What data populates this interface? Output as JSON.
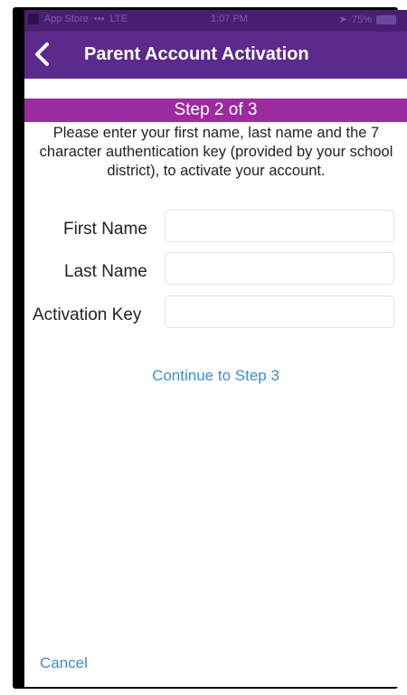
{
  "status_bar": {
    "carrier": "App Store",
    "network": "LTE",
    "time": "1:07 PM",
    "battery": "75%"
  },
  "nav": {
    "title": "Parent Account Activation",
    "back_icon": "chevron-left-icon"
  },
  "step": {
    "label": "Step 2 of 3"
  },
  "instructions": "Please enter your first name, last name and the 7 character authentication key (provided by your school district), to activate your account.",
  "form": {
    "first_name_label": "First Name",
    "first_name_value": "",
    "last_name_label": "Last Name",
    "last_name_value": "",
    "activation_key_label": "Activation Key",
    "activation_key_value": ""
  },
  "actions": {
    "continue_label": "Continue to Step 3",
    "cancel_label": "Cancel"
  },
  "colors": {
    "nav_background": "#5b2a8c",
    "step_background": "#9b2b9e",
    "link": "#3d8ed1"
  }
}
